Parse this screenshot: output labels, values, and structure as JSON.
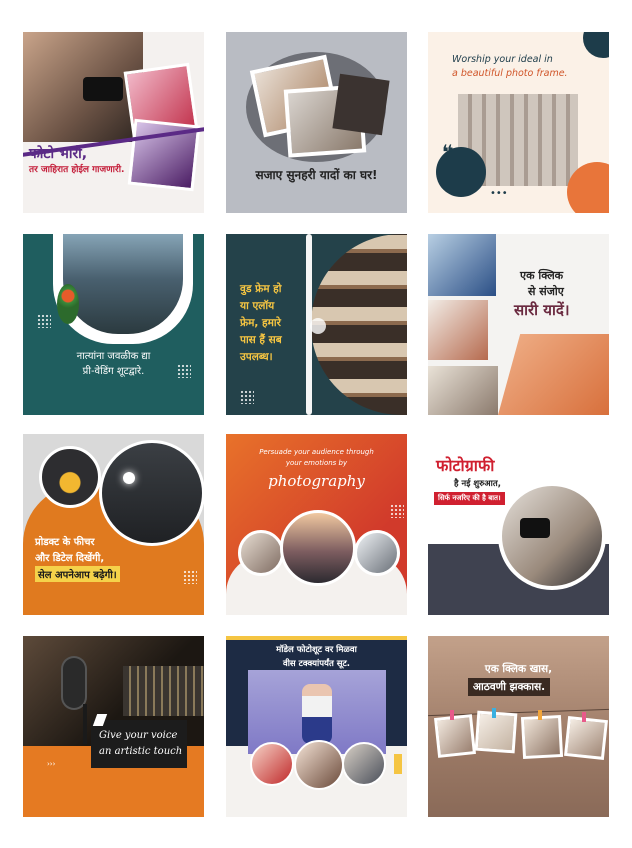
{
  "tiles": {
    "t1": {
      "line1": "फोटो भारी,",
      "line2": "तर जाहिरात होईल गाजणारी."
    },
    "t2": {
      "text": "सजाए सुनहरी यादों का घर!"
    },
    "t3": {
      "line1": "Worship your ideal in",
      "line2": "a beautiful photo frame.",
      "quote_icon": "quote-icon",
      "dots": "•••"
    },
    "t4": {
      "line1": "नात्यांना जवळीक द्या",
      "line2": "प्री-वेडिंग शूटद्वारे."
    },
    "t5": {
      "lines": [
        "वुड फ्रेम हो",
        "या एलॉय",
        "फ्रेम, हमारे",
        "पास हैं सब",
        "उपलब्ध।"
      ]
    },
    "t6": {
      "line1": "एक क्लिक",
      "line2": "से संजोए",
      "line3": "सारी यादें।"
    },
    "t7": {
      "line1": "प्रोडक्ट के फीचर",
      "line2": "और डिटेल दिखेंगी,",
      "line3": "सेल अपनेआप बढ़ेगी।"
    },
    "t8": {
      "line1": "Persuade your audience through",
      "line2": "your emotions by",
      "line3": "photography"
    },
    "t9": {
      "line1": "फोटोग्राफी",
      "line2": "है नई शुरुआत,",
      "line3": "सिर्फ नजरिए की है बात।"
    },
    "t10": {
      "line1": "Give your voice",
      "line2": "an artistic touch"
    },
    "t11": {
      "line1": "मॉडेल फोटोशूट वर मिळवा",
      "line2": "वीस टक्क्यांपर्यंत सूट."
    },
    "t12": {
      "line1": "एक क्लिक खास,",
      "line2": "आठवणी झक्कास."
    }
  },
  "colors": {
    "purple": "#5b2a86",
    "red": "#d02030",
    "orange": "#e07a1f",
    "teal": "#1f6a6a",
    "navy": "#1d2b44",
    "slate": "#3f4250"
  }
}
